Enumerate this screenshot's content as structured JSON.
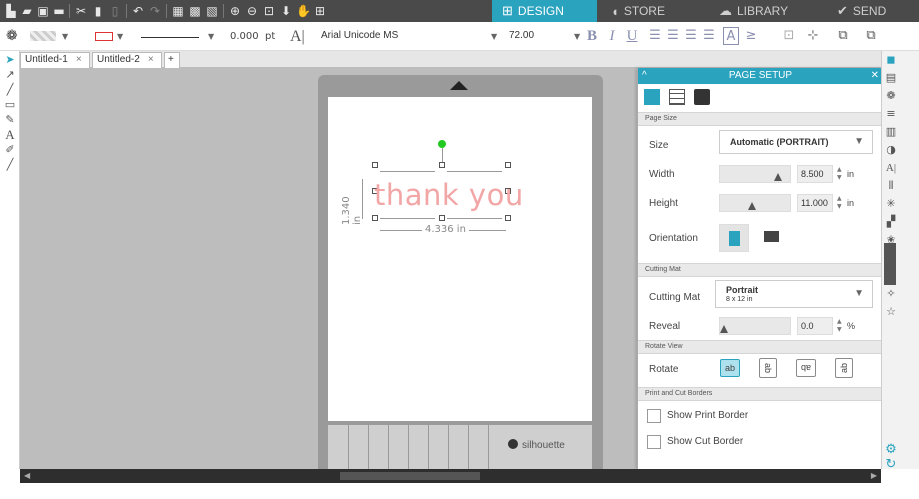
{
  "nav": {
    "design": "DESIGN",
    "store": "STORE",
    "library": "LIBRARY",
    "send": "SEND",
    "active_color": "#2aa3bf"
  },
  "toolbar": {
    "line_weight": "0.000",
    "line_unit": "pt",
    "font_name": "Arial Unicode MS",
    "font_size": "72.00"
  },
  "doc_tabs": [
    {
      "label": "Untitled-1"
    },
    {
      "label": "Untitled-2"
    }
  ],
  "canvas": {
    "text": "thank you",
    "text_color": "#f2a6a6",
    "width_dim": "4.336 in",
    "height_dim": "1.340 in",
    "brand": "silhouette"
  },
  "panel": {
    "title": "PAGE SETUP",
    "page_size_section": "Page Size",
    "size_label": "Size",
    "size_value": "Automatic (PORTRAIT)",
    "width_label": "Width",
    "width_value": "8.500",
    "width_unit": "in",
    "height_label": "Height",
    "height_value": "11.000",
    "height_unit": "in",
    "orientation_label": "Orientation",
    "cutting_mat_section": "Cutting Mat",
    "cutting_mat_label": "Cutting Mat",
    "cutting_mat_value": "Portrait",
    "cutting_mat_sub": "8 x 12 in",
    "reveal_label": "Reveal",
    "reveal_value": "0.0",
    "reveal_unit": "%",
    "rotate_view_section": "Rotate View",
    "rotate_label": "Rotate",
    "rotate_options": [
      "ab",
      "ab",
      "ab",
      "ab"
    ],
    "print_cut_section": "Print and Cut Borders",
    "show_print_border": "Show Print Border",
    "show_cut_border": "Show Cut Border"
  }
}
